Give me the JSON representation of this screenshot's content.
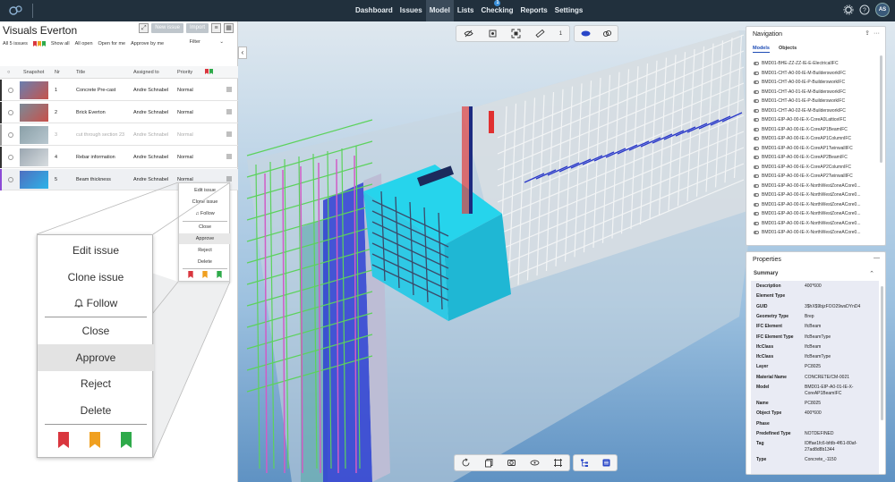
{
  "topbar": {
    "nav": [
      {
        "label": "Dashboard"
      },
      {
        "label": "Issues"
      },
      {
        "label": "Model",
        "active": true
      },
      {
        "label": "Lists"
      },
      {
        "label": "Checking",
        "badge": "1"
      },
      {
        "label": "Reports"
      },
      {
        "label": "Settings"
      }
    ],
    "user_initials": "AS",
    "icons": [
      "gear-icon",
      "help-icon"
    ]
  },
  "issues_panel": {
    "title": "Visuals Everton",
    "new_issue_label": "New issue",
    "import_label": "Import",
    "filters": {
      "count_label": "All 5 issues",
      "show_all": "Show all",
      "all_open": "All open",
      "open_for_me": "Open for me",
      "approve_by_me": "Approve by me",
      "filter": "Filter"
    },
    "columns": {
      "snapshot": "Snapshot",
      "nr": "Nr",
      "title": "Title",
      "assigned_to": "Assigned to",
      "priority": "Priority"
    },
    "rows": [
      {
        "nr": "1",
        "title": "Concrete Pre-cast",
        "assigned": "Andre Schnabel",
        "priority": "Normal"
      },
      {
        "nr": "2",
        "title": "Brick Everton",
        "assigned": "Andre Schnabel",
        "priority": "Normal"
      },
      {
        "nr": "3",
        "title": "cut through section 23",
        "assigned": "Andre Schnabel",
        "priority": "Normal"
      },
      {
        "nr": "4",
        "title": "Rebar information",
        "assigned": "Andre Schnabel",
        "priority": "Normal"
      },
      {
        "nr": "5",
        "title": "Beam thickness",
        "assigned": "Andre Schnabel",
        "priority": "Normal"
      }
    ]
  },
  "context_menu": {
    "edit": "Edit issue",
    "clone": "Clone issue",
    "follow": "Follow",
    "close": "Close",
    "approve": "Approve",
    "reject": "Reject",
    "delete": "Delete",
    "flag_colors": [
      "#d9363e",
      "#f0a020",
      "#2eaa4a"
    ]
  },
  "viewer": {
    "tool_count": "1",
    "colors": {
      "sky_top": "#dfe8ef",
      "sky_bottom": "#5f92c3",
      "highlight": "#1ad3ea"
    }
  },
  "navigation": {
    "title": "Navigation",
    "tab_models": "Models",
    "tab_objects": "Objects",
    "models": [
      "BMD01-BHE-ZZ-ZZ-IE-E-ElectricalIFC",
      "BMD01-CHT-A0-00-IE-M-BuildersworkIFC",
      "BMD01-CHT-A0-00-IE-P-BuildersworkIFC",
      "BMD01-CHT-A0-01-IE-M-BuildersworkIFC",
      "BMD01-CHT-A0-01-IE-P-BuildersworkIFC",
      "BMD01-CHT-A0-02-IE-M-BuildersworkIFC",
      "BMD01-EIP-A0-00-IE-X-CoreA0LatticeIFC",
      "BMD01-EIP-A0-00-IE-X-CoreAP1BeamIFC",
      "BMD01-EIP-A0-00-IE-X-CoreAP1ColumnIFC",
      "BMD01-EIP-A0-00-IE-X-CoreAP1TwinwallIFC",
      "BMD01-EIP-A0-00-IE-X-CoreAP2BeamIFC",
      "BMD01-EIP-A0-00-IE-X-CoreAP2ColumnIFC",
      "BMD01-EIP-A0-00-IE-X-CoreAP2TwinwallIFC",
      "BMD01-EIP-A0-00-IE-X-NorthWestZoneACore0...",
      "BMD01-EIP-A0-00-IE-X-NorthWestZoneACore0...",
      "BMD01-EIP-A0-00-IE-X-NorthWestZoneACore0...",
      "BMD01-EIP-A0-00-IE-X-NorthWestZoneACore0...",
      "BMD01-EIP-A0-00-IE-X-NorthWestZoneACore0...",
      "BMD01-EIP-A0-00-IE-X-NorthWestZoneACore0..."
    ]
  },
  "properties": {
    "title": "Properties",
    "section": "Summary",
    "rows": [
      {
        "k": "Description",
        "v": "400*600"
      },
      {
        "k": "Element Type",
        "v": ""
      },
      {
        "k": "GUID",
        "v": "3$hX$9bjzFOO29wsDYnD4"
      },
      {
        "k": "Geometry Type",
        "v": "Brep"
      },
      {
        "k": "IFC Element",
        "v": "IfcBeam"
      },
      {
        "k": "IFC Element Type",
        "v": "IfcBeamType"
      },
      {
        "k": "IfcClass",
        "v": "IfcBeam"
      },
      {
        "k": "IfcClass",
        "v": "IfcBeamType"
      },
      {
        "k": "Layer",
        "v": "PC8025"
      },
      {
        "k": "Material Name",
        "v": "CONCRETE/CM-0021"
      },
      {
        "k": "Model",
        "v": "BMD01-EIP-A0-01-IE-X-CoreAP1BeamIFC"
      },
      {
        "k": "Name",
        "v": "PC8025"
      },
      {
        "k": "Object Type",
        "v": "400*600"
      },
      {
        "k": "Phase",
        "v": ""
      },
      {
        "k": "Predefined Type",
        "v": "NOTDEFINED"
      },
      {
        "k": "Tag",
        "v": "IDffae1fc6-bfdb-4f61-80af-27ad8d8b1344"
      },
      {
        "k": "Type",
        "v": "Concrete_-1150"
      }
    ]
  }
}
